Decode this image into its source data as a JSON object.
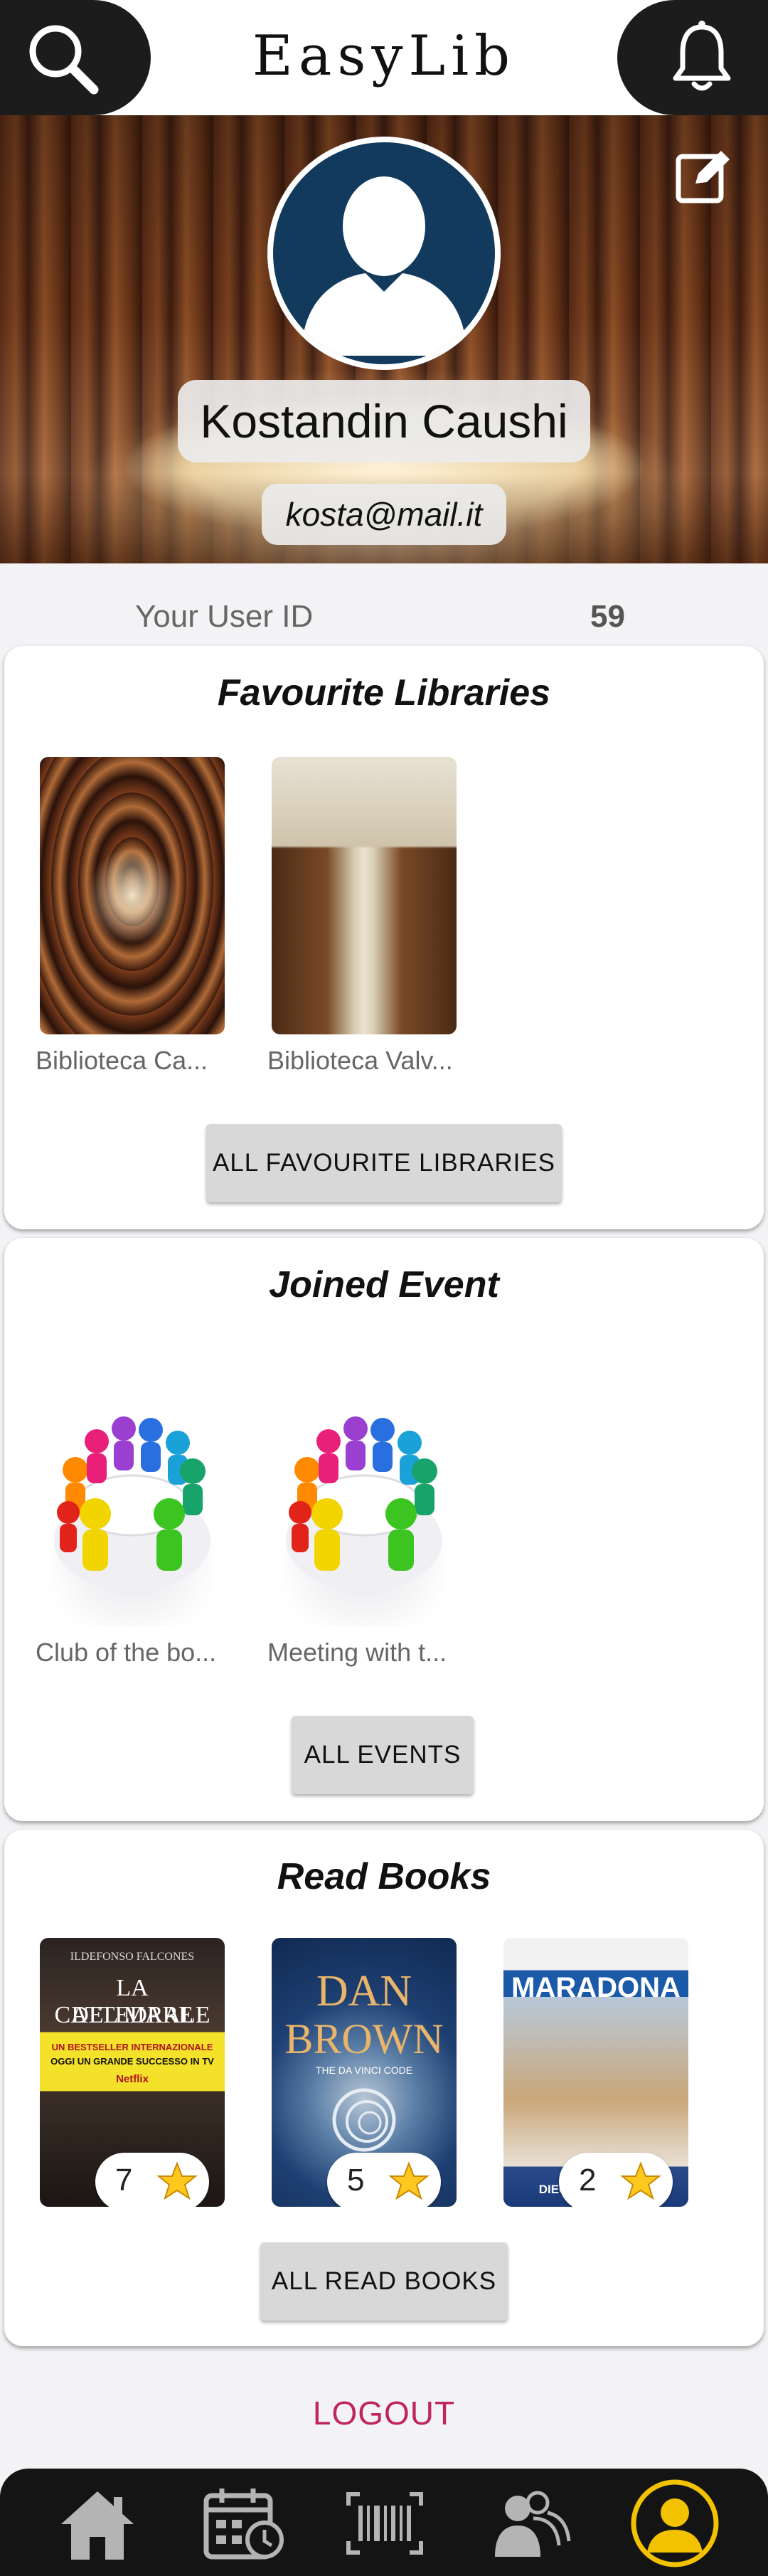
{
  "header": {
    "title": "EasyLib",
    "search_icon": "search-icon",
    "notification_icon": "bell-icon"
  },
  "profile": {
    "name": "Kostandin Caushi",
    "email": "kosta@mail.it",
    "edit_icon": "edit-icon",
    "user_id_label": "Your User ID",
    "user_id": "59"
  },
  "favourite_libraries": {
    "title": "Favourite Libraries",
    "items": [
      {
        "caption": "Biblioteca Ca..."
      },
      {
        "caption": "Biblioteca Valv..."
      }
    ],
    "button_label": "ALL FAVOURITE LIBRARIES"
  },
  "joined_events": {
    "title": "Joined Event",
    "items": [
      {
        "caption": "Club of the bo..."
      },
      {
        "caption": "Meeting with t..."
      }
    ],
    "button_label": "ALL EVENTS"
  },
  "read_books": {
    "title": "Read Books",
    "items": [
      {
        "rating": "7",
        "cover_lines": [
          "ILDEFONSO FALCONES",
          "LA CATTEDRALE",
          "DEL MARE",
          "UN BESTSELLER INTERNAZIONALE",
          "OGGI UN GRANDE SUCCESSO IN TV",
          "Netflix"
        ]
      },
      {
        "rating": "5",
        "cover_lines": [
          "DAN",
          "BROWN",
          "THE DA VINCI CODE"
        ]
      },
      {
        "rating": "2",
        "cover_lines": [
          "MARADONA",
          "DIEGO MARADONA"
        ]
      }
    ],
    "button_label": "ALL READ BOOKS"
  },
  "logout_label": "LOGOUT",
  "bottom_nav": {
    "items": [
      "home-icon",
      "calendar-icon",
      "barcode-icon",
      "community-icon",
      "profile-icon"
    ],
    "active": "profile-icon"
  },
  "colors": {
    "header_dark": "#1c1c1c",
    "logout": "#c0265c",
    "active_nav": "#f2c200",
    "avatar_bg": "#123a5c"
  }
}
